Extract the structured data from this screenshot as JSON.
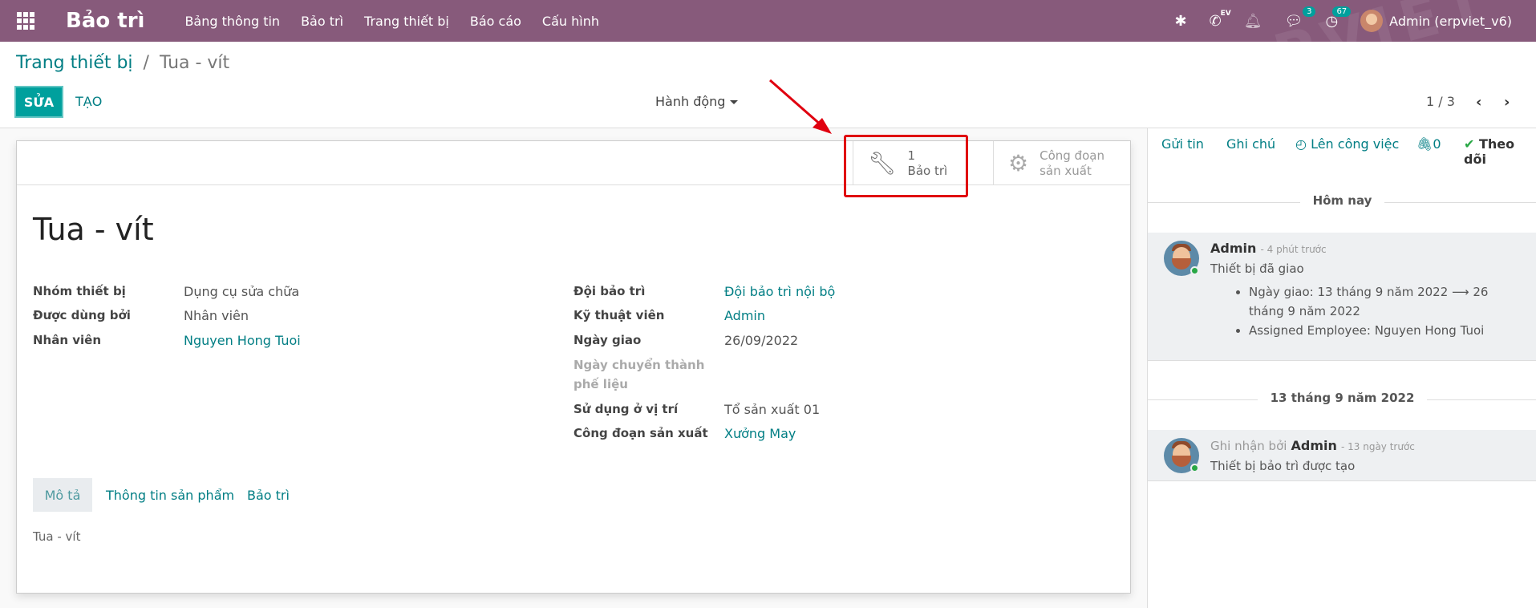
{
  "navbar": {
    "app_title": "Bảo trì",
    "menu": [
      "Bảng thông tin",
      "Bảo trì",
      "Trang thiết bị",
      "Báo cáo",
      "Cấu hình"
    ],
    "ev_label": "EV",
    "messages_count": "3",
    "activities_count": "67",
    "user": "Admin (erpviet_v6)"
  },
  "breadcrumb": {
    "parent": "Trang thiết bị",
    "separator": "/",
    "current": "Tua - vít"
  },
  "control": {
    "edit_label": "SỬA",
    "create_label": "TẠO",
    "actions_label": "Hành động",
    "pager": "1 / 3"
  },
  "smart_buttons": {
    "maintenance_count": "1",
    "maintenance_label": "Bảo trì",
    "workcenter_label_1": "Công đoạn",
    "workcenter_label_2": "sản xuất"
  },
  "form": {
    "title": "Tua - vít",
    "left_fields": [
      {
        "label": "Nhóm thiết bị",
        "value": "Dụng cụ sửa chữa"
      },
      {
        "label": "Được dùng bởi",
        "value": "Nhân viên"
      },
      {
        "label": "Nhân viên",
        "value": "Nguyen Hong Tuoi"
      }
    ],
    "right_fields": [
      {
        "label": "Đội bảo trì",
        "value": "Đội bảo trì nội bộ"
      },
      {
        "label": "Kỹ thuật viên",
        "value": "Admin"
      },
      {
        "label": "Ngày giao",
        "value": "26/09/2022"
      },
      {
        "label_1": "Ngày chuyển thành",
        "label_2": "phế liệu"
      },
      {
        "label": "Sử dụng ở vị trí",
        "value": "Tổ sản xuất 01"
      },
      {
        "label": "Công đoạn sản xuất",
        "value": "Xưởng May"
      }
    ],
    "tabs": [
      "Mô tả",
      "Thông tin sản phẩm",
      "Bảo trì"
    ],
    "description": "Tua - vít"
  },
  "chatter": {
    "send_message": "Gửi tin",
    "log_note": "Ghi chú",
    "schedule_activity": "Lên công việc",
    "attachments": "0",
    "follow": "Theo dõi",
    "sep_today": "Hôm nay",
    "msg1": {
      "author": "Admin",
      "ago": "- 4 phút trước",
      "text": "Thiết bị đã giao",
      "track1_a": "Ngày giao: 13 tháng 9 năm 2022",
      "track1_b": "26 tháng 9",
      "track1_c": "năm 2022",
      "track2": "Assigned Employee: Nguyen Hong Tuoi"
    },
    "sep_date": "13 tháng 9 năm 2022",
    "msg2": {
      "prefix": "Ghi nhận bởi",
      "author": "Admin",
      "ago": "- 13 ngày trước",
      "text": "Thiết bị bảo trì được tạo"
    }
  }
}
